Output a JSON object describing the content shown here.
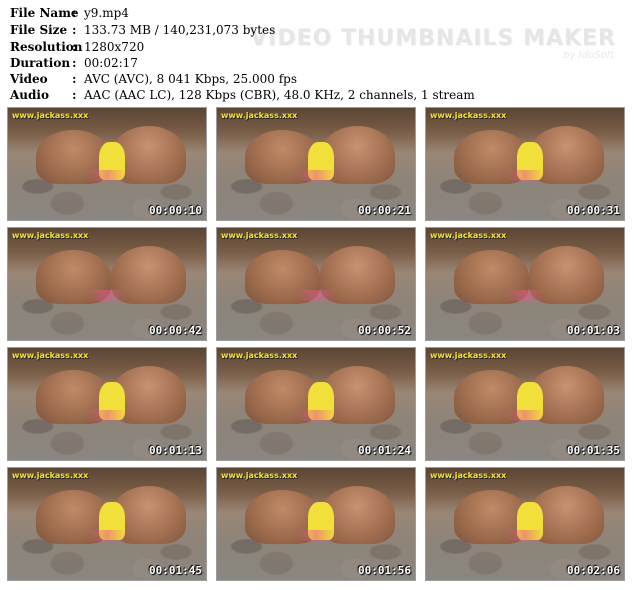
{
  "meta": [
    {
      "label": "File Name",
      "value": "y9.mp4"
    },
    {
      "label": "File Size",
      "value": "133.73 MB  /  140,231,073  bytes"
    },
    {
      "label": "Resolution",
      "value": "1280x720"
    },
    {
      "label": "Duration",
      "value": "00:02:17"
    },
    {
      "label": "Video",
      "value": "AVC (AVC), 8 041 Kbps, 25.000 fps"
    },
    {
      "label": "Audio",
      "value": "AAC (AAC LC), 128 Kbps (CBR), 48.0 KHz, 2 channels, 1 stream"
    }
  ],
  "colon": ":",
  "watermark": {
    "title": "VIDEO THUMBNAILS MAKER",
    "sub": "by IdoSoft"
  },
  "thumbnails": [
    {
      "logo": "www.jackass.xxx",
      "time": "00:00:10"
    },
    {
      "logo": "www.jackass.xxx",
      "time": "00:00:21"
    },
    {
      "logo": "www.jackass.xxx",
      "time": "00:00:31"
    },
    {
      "logo": "www.jackass.xxx",
      "time": "00:00:42"
    },
    {
      "logo": "www.jackass.xxx",
      "time": "00:00:52"
    },
    {
      "logo": "www.jackass.xxx",
      "time": "00:01:03"
    },
    {
      "logo": "www.jackass.xxx",
      "time": "00:01:13"
    },
    {
      "logo": "www.jackass.xxx",
      "time": "00:01:24"
    },
    {
      "logo": "www.jackass.xxx",
      "time": "00:01:35"
    },
    {
      "logo": "www.jackass.xxx",
      "time": "00:01:45"
    },
    {
      "logo": "www.jackass.xxx",
      "time": "00:01:56"
    },
    {
      "logo": "www.jackass.xxx",
      "time": "00:02:06"
    }
  ]
}
